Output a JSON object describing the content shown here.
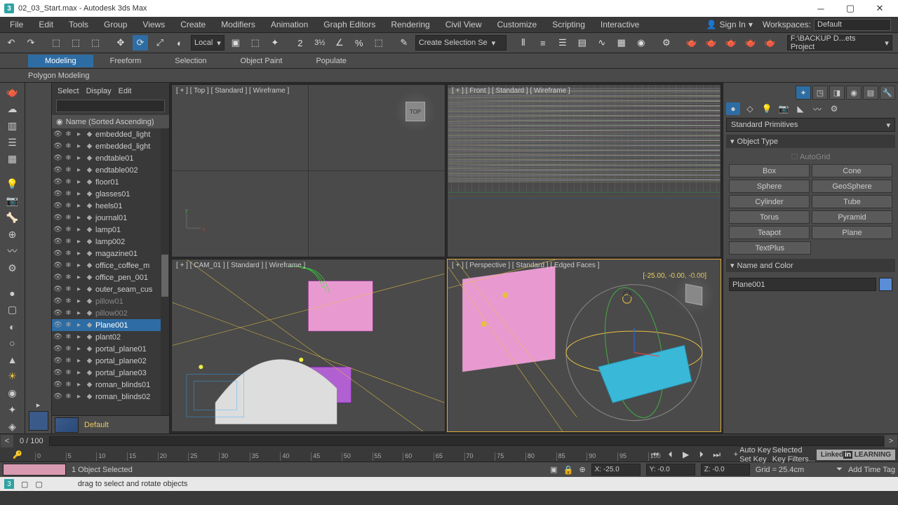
{
  "title": "02_03_Start.max - Autodesk 3ds Max",
  "menu": [
    "File",
    "Edit",
    "Tools",
    "Group",
    "Views",
    "Create",
    "Modifiers",
    "Animation",
    "Graph Editors",
    "Rendering",
    "Civil View",
    "Customize",
    "Scripting",
    "Interactive"
  ],
  "signin": "Sign In",
  "workspaces_label": "Workspaces:",
  "workspaces_value": "Default",
  "coord_sys": "Local",
  "sel_set": "Create Selection Se",
  "project_path": "F:\\BACKUP D...ets Project",
  "ribbon_tabs": [
    "Modeling",
    "Freeform",
    "Selection",
    "Object Paint",
    "Populate"
  ],
  "subribbon": "Polygon Modeling",
  "scene_tabs": [
    "Select",
    "Display",
    "Edit"
  ],
  "scene_header": "Name (Sorted Ascending)",
  "scene_items": [
    {
      "name": "embedded_light",
      "sel": false
    },
    {
      "name": "embedded_light",
      "sel": false
    },
    {
      "name": "endtable01",
      "sel": false
    },
    {
      "name": "endtable002",
      "sel": false
    },
    {
      "name": "floor01",
      "sel": false
    },
    {
      "name": "glasses01",
      "sel": false
    },
    {
      "name": "heels01",
      "sel": false
    },
    {
      "name": "journal01",
      "sel": false
    },
    {
      "name": "lamp01",
      "sel": false
    },
    {
      "name": "lamp002",
      "sel": false
    },
    {
      "name": "magazine01",
      "sel": false
    },
    {
      "name": "office_coffee_m",
      "sel": false
    },
    {
      "name": "office_pen_001",
      "sel": false
    },
    {
      "name": "outer_seam_cus",
      "sel": false
    },
    {
      "name": "pillow01",
      "sel": false,
      "dim": true
    },
    {
      "name": "pillow002",
      "sel": false,
      "dim": true
    },
    {
      "name": "Plane001",
      "sel": true
    },
    {
      "name": "plant02",
      "sel": false
    },
    {
      "name": "portal_plane01",
      "sel": false
    },
    {
      "name": "portal_plane02",
      "sel": false
    },
    {
      "name": "portal_plane03",
      "sel": false
    },
    {
      "name": "roman_blinds01",
      "sel": false
    },
    {
      "name": "roman_blinds02",
      "sel": false
    }
  ],
  "layer_name": "Default",
  "vp_labels": {
    "tl": "[ + ] [ Top ] [ Standard ] [ Wireframe ]",
    "tr": "[ + ] [ Front ] [ Standard ] [ Wireframe ]",
    "bl": "[ + ] [ CAM_01 ] [ Standard ] [ Wireframe ]",
    "br": "[ + ] [ Perspective ] [ Standard ] [ Edged Faces ]"
  },
  "cube_top": "TOP",
  "persp_coord": "[-25.00, -0.00, -0.00]",
  "cmd_dropdown": "Standard Primitives",
  "roll_obj": "Object Type",
  "autogrid": "AutoGrid",
  "primitives": [
    "Box",
    "Cone",
    "Sphere",
    "GeoSphere",
    "Cylinder",
    "Tube",
    "Torus",
    "Pyramid",
    "Teapot",
    "Plane",
    "TextPlus"
  ],
  "roll_name": "Name and Color",
  "obj_name": "Plane001",
  "frame_label": "0 / 100",
  "time_ticks": [
    "0",
    "5",
    "10",
    "15",
    "20",
    "25",
    "30",
    "35",
    "40",
    "45",
    "50",
    "55",
    "60",
    "65",
    "70",
    "75",
    "80",
    "85",
    "90",
    "95",
    "100"
  ],
  "status_sel": "1 Object Selected",
  "status_x": "X: -25.0",
  "status_y": "Y: -0.0",
  "status_z": "Z: -0.0",
  "status_grid": "Grid = 25.4cm",
  "autokey": "Auto Key",
  "setkey": "Set Key",
  "selected": "Selected",
  "keyfilters": "Key Filters...",
  "addtag": "Add Time Tag",
  "learning": "LEARNING",
  "bottom_hint": "drag to select and rotate objects"
}
